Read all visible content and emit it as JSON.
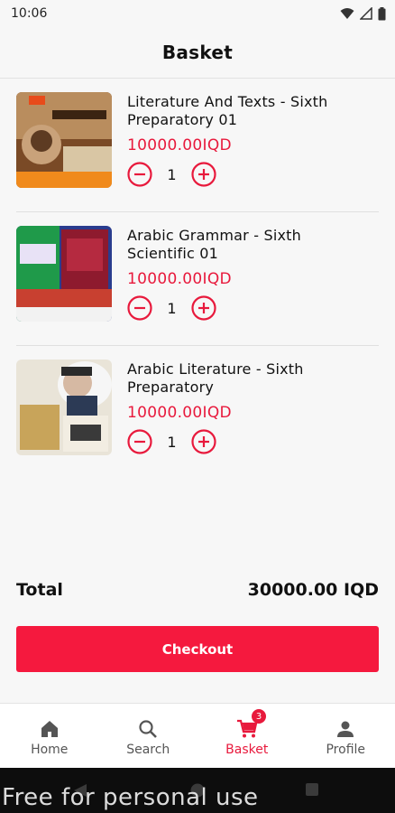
{
  "status_bar": {
    "time": "10:06"
  },
  "header": {
    "title": "Basket"
  },
  "cart": {
    "items": [
      {
        "title": "Literature And Texts - Sixth Preparatory 01",
        "price": "10000.00IQD",
        "quantity": "1"
      },
      {
        "title": "Arabic Grammar - Sixth Scientific 01",
        "price": "10000.00IQD",
        "quantity": "1"
      },
      {
        "title": "Arabic Literature - Sixth Preparatory",
        "price": "10000.00IQD",
        "quantity": "1"
      }
    ]
  },
  "summary": {
    "total_label": "Total",
    "total_value": "30000.00 IQD"
  },
  "checkout": {
    "label": "Checkout"
  },
  "nav": {
    "items": [
      {
        "label": "Home",
        "icon": "home-icon"
      },
      {
        "label": "Search",
        "icon": "search-icon"
      },
      {
        "label": "Basket",
        "icon": "cart-icon",
        "badge": "3",
        "active": true
      },
      {
        "label": "Profile",
        "icon": "person-icon"
      }
    ]
  },
  "watermark": "Free for personal use",
  "colors": {
    "accent": "#e8193c",
    "checkout": "#f5193e",
    "background": "#f7f7f7"
  }
}
